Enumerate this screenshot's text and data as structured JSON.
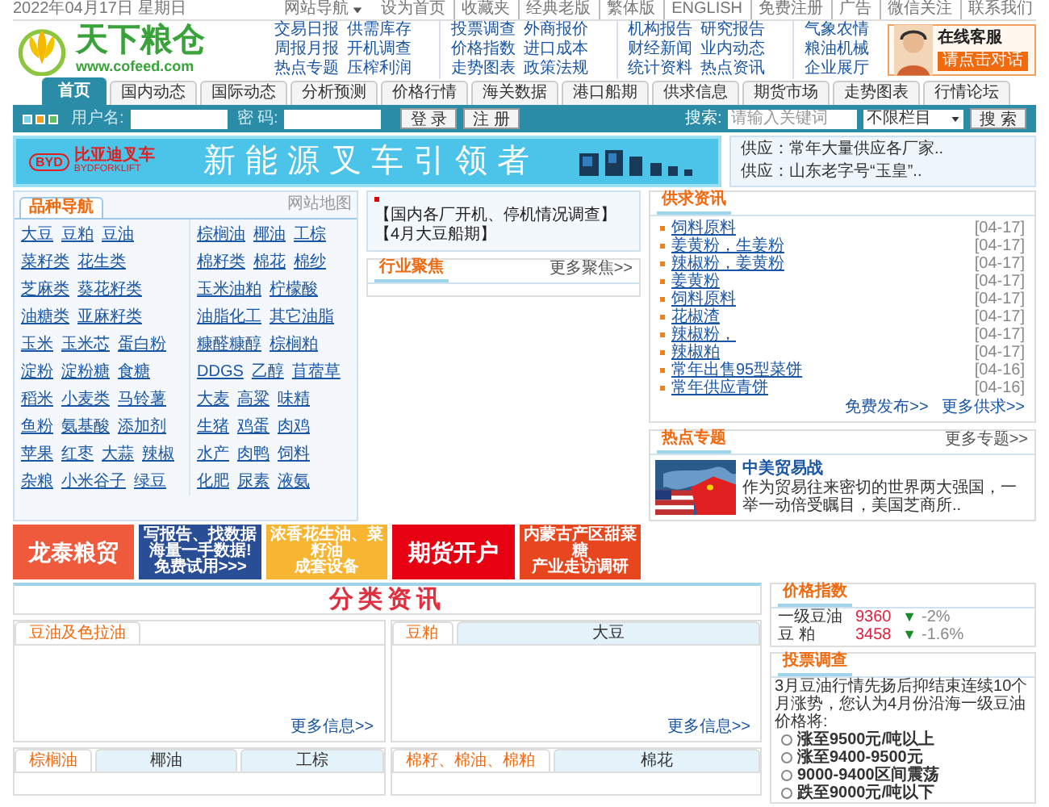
{
  "top_bar": {
    "date": "2022年04月17日 星期日",
    "site_nav": "网站导航",
    "links": [
      "设为首页",
      "收藏夹",
      "经典老版",
      "繁体版",
      "ENGLISH",
      "免费注册",
      "广告",
      "微信关注",
      "联系我们"
    ]
  },
  "header": {
    "logo": "天下粮仓",
    "logo_url": "www.cofeed.com",
    "link_groups": [
      [
        [
          "交易日报",
          "供需库存"
        ],
        [
          "周报月报",
          "开机调查"
        ],
        [
          "热点专题",
          "压榨利润"
        ]
      ],
      [
        [
          "投票调查",
          "外商报价"
        ],
        [
          "价格指数",
          "进口成本"
        ],
        [
          "走势图表",
          "政策法规"
        ]
      ],
      [
        [
          "机构报告",
          "研究报告"
        ],
        [
          "财经新闻",
          "业内动态"
        ],
        [
          "统计资料",
          "热点资讯"
        ]
      ],
      [
        [
          "气象农情"
        ],
        [
          "粮油机械"
        ],
        [
          "企业展厅"
        ]
      ]
    ],
    "service": {
      "title": "在线客服",
      "button": "请点击对话"
    }
  },
  "nav_tabs": [
    {
      "label": "首页",
      "selected": true
    },
    {
      "label": "国内动态",
      "selected": false
    },
    {
      "label": "国际动态",
      "selected": false
    },
    {
      "label": "分析预测",
      "selected": false
    },
    {
      "label": "价格行情",
      "selected": false
    },
    {
      "label": "海关数据",
      "selected": false
    },
    {
      "label": "港口船期",
      "selected": false
    },
    {
      "label": "供求信息",
      "selected": false
    },
    {
      "label": "期货市场",
      "selected": false
    },
    {
      "label": "走势图表",
      "selected": false
    },
    {
      "label": "行情论坛",
      "selected": false
    }
  ],
  "login_bar": {
    "username_label": "用户名:",
    "password_label": "密 码:",
    "login_button": "登 录",
    "register_button": "注 册",
    "search_label": "搜索:",
    "search_placeholder": "请输入关键词",
    "category_select": "不限栏目",
    "search_button": "搜 索"
  },
  "banner": {
    "brand": "BYD",
    "brand_name": "比亚迪叉车",
    "brand_sub": "BYDFORKLIFT",
    "headline": "新能源叉车引领者"
  },
  "supply_ticker": [
    "供应：常年大量供应各厂家..",
    "供应：山东老字号“玉皇”.."
  ],
  "category_nav": {
    "title": "品种导航",
    "site_map": "网站地图",
    "left": [
      [
        "大豆",
        "豆粕",
        "豆油"
      ],
      [
        "菜籽类",
        "花生类"
      ],
      [
        "芝麻类",
        "葵花籽类"
      ],
      [
        "油糖类",
        "亚麻籽类"
      ],
      [
        "玉米",
        "玉米芯",
        "蛋白粉"
      ],
      [
        "淀粉",
        "淀粉糖",
        "食糖"
      ],
      [
        "稻米",
        "小麦类",
        "马铃薯"
      ],
      [
        "鱼粉",
        "氨基酸",
        "添加剂"
      ],
      [
        "苹果",
        "红枣",
        "大蒜",
        "辣椒"
      ],
      [
        "杂粮",
        "小米谷子",
        "绿豆"
      ]
    ],
    "right": [
      [
        "棕榈油",
        "椰油",
        "工棕"
      ],
      [
        "棉籽类",
        "棉花",
        "棉纱"
      ],
      [
        "玉米油粕",
        "柠檬酸"
      ],
      [
        "油脂化工",
        "其它油脂"
      ],
      [
        "糠醛糠醇",
        "棕榈粕"
      ],
      [
        "DDGS",
        "乙醇",
        "苜蓿草"
      ],
      [
        "大麦",
        "高粱",
        "味精"
      ],
      [
        "生猪",
        "鸡蛋",
        "肉鸡"
      ],
      [
        "水产",
        "肉鸭",
        "饲料"
      ],
      [
        "化肥",
        "尿素",
        "液氨"
      ]
    ]
  },
  "headline_box": {
    "links": [
      "【国内各厂开机、停机情况调查】",
      "【4月大豆船期】"
    ]
  },
  "industry_focus": {
    "title": "行业聚焦",
    "more": "更多聚焦>>"
  },
  "supply_news": {
    "title": "供求资讯",
    "items": [
      {
        "text": "饲料原料",
        "date": "[04-17]"
      },
      {
        "text": "姜黄粉，生姜粉",
        "date": "[04-17]"
      },
      {
        "text": "辣椒粉，姜黄粉",
        "date": "[04-17]"
      },
      {
        "text": "姜黄粉",
        "date": "[04-17]"
      },
      {
        "text": "饲料原料",
        "date": "[04-17]"
      },
      {
        "text": "花椒渣",
        "date": "[04-17]"
      },
      {
        "text": "辣椒粉，",
        "date": "[04-17]"
      },
      {
        "text": "辣椒粕",
        "date": "[04-17]"
      },
      {
        "text": "常年出售95型菜饼",
        "date": "[04-16]"
      },
      {
        "text": "常年供应青饼",
        "date": "[04-16]"
      }
    ],
    "links": [
      "免费发布>>",
      "更多供求>>"
    ]
  },
  "hot_topic": {
    "title": "热点专题",
    "more": "更多专题>>",
    "item_title": "中美贸易战",
    "summary": "作为贸易往来密切的世界两大强国，一举一动倍受瞩目，美国芝商所.."
  },
  "ads": [
    {
      "lines": [
        "龙泰粮贸"
      ],
      "color": "#f05a3c"
    },
    {
      "lines": [
        "写报告、找数据",
        "海量一手数据!",
        "免费试用>>>"
      ],
      "color": "#2a4e96"
    },
    {
      "lines": [
        "浓香花生油、菜籽油",
        "成套设备"
      ],
      "color": "#f7b531"
    },
    {
      "lines": [
        "期货开户"
      ],
      "color": "#e60012"
    },
    {
      "lines": [
        "内蒙古产区甜菜糖",
        "产业走访调研"
      ],
      "color": "#e8461e"
    }
  ],
  "category_news": {
    "title": "分类资讯",
    "panels": [
      {
        "tabs": [
          {
            "label": "豆油及色拉油",
            "selected": true
          }
        ],
        "more": "更多信息>>"
      },
      {
        "tabs": [
          {
            "label": "豆粕",
            "selected": true
          },
          {
            "label": "大豆",
            "selected": false
          }
        ],
        "more": "更多信息>>"
      },
      {
        "tabs": [
          {
            "label": "棕榈油",
            "selected": true
          },
          {
            "label": "椰油",
            "selected": false
          },
          {
            "label": "工棕",
            "selected": false
          }
        ]
      },
      {
        "tabs": [
          {
            "label": "棉籽、棉油、棉粕",
            "selected": true
          },
          {
            "label": "棉花",
            "selected": false
          }
        ]
      }
    ]
  },
  "price_index": {
    "title": "价格指数",
    "rows": [
      {
        "name": "一级豆油",
        "price": "9360",
        "falling": true,
        "change": "-2%"
      },
      {
        "name": "豆 粕",
        "price": "3458",
        "falling": true,
        "change": "-1.6%"
      }
    ]
  },
  "poll": {
    "title": "投票调查",
    "question": "3月豆油行情先扬后抑结束连续10个月涨势，您认为4月份沿海一级豆油价格将:",
    "options": [
      {
        "label": "涨至9500元/吨以上",
        "checked": false
      },
      {
        "label": "涨至9400-9500元",
        "checked": false
      },
      {
        "label": "9000-9400区间震荡",
        "checked": false
      },
      {
        "label": "跌至9000元/吨以下",
        "checked": false
      }
    ]
  }
}
